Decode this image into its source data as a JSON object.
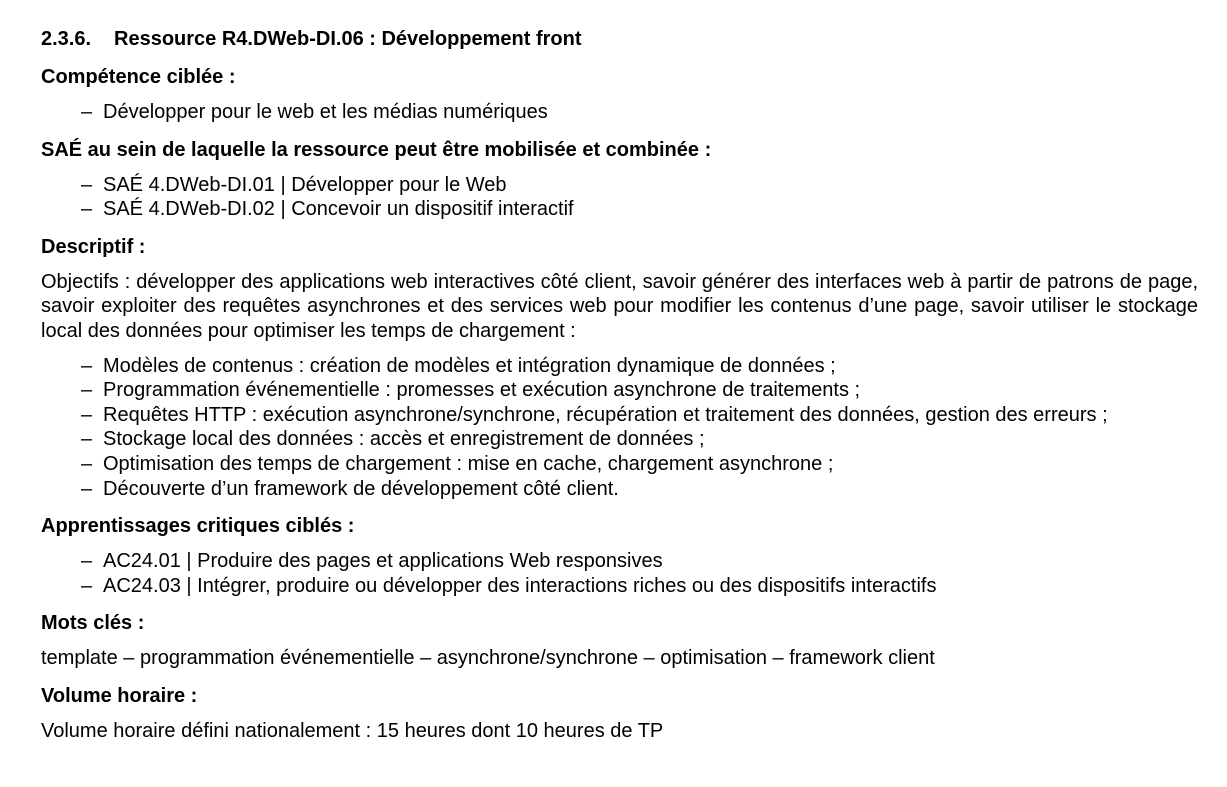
{
  "section": {
    "number": "2.3.6.",
    "title": "Ressource R4.DWeb-DI.06 : Développement front"
  },
  "competence": {
    "label": "Compétence ciblée :",
    "items": [
      "Développer pour le web et les médias numériques"
    ]
  },
  "sae": {
    "label": "SAÉ au sein de laquelle la ressource peut être mobilisée et combinée :",
    "items": [
      "SAÉ 4.DWeb-DI.01 | Développer pour le Web",
      "SAÉ 4.DWeb-DI.02 | Concevoir un dispositif interactif"
    ]
  },
  "descriptif": {
    "label": "Descriptif :",
    "paragraph": "Objectifs : développer des applications web interactives côté client, savoir générer des interfaces web à partir de patrons de page, savoir exploiter des requêtes asynchrones et des services web pour modifier les contenus d’une page, savoir utiliser le stockage local des données pour optimiser les temps de chargement :",
    "items": [
      "Modèles de contenus : création de modèles et intégration dynamique de données ;",
      "Programmation événementielle : promesses et exécution asynchrone de traitements ;",
      "Requêtes HTTP : exécution asynchrone/synchrone, récupération et traitement des données, gestion des erreurs ;",
      "Stockage local des données : accès et enregistrement de données ;",
      "Optimisation des temps de chargement : mise en cache, chargement asynchrone ;",
      "Découverte d’un framework de développement côté client."
    ]
  },
  "apprentissages": {
    "label": "Apprentissages critiques ciblés :",
    "items": [
      "AC24.01 | Produire des pages et applications Web responsives",
      "AC24.03 | Intégrer, produire ou développer des interactions riches ou des dispositifs interactifs"
    ]
  },
  "mots_cles": {
    "label": "Mots clés :",
    "text": "template – programmation événementielle – asynchrone/synchrone – optimisation – framework client"
  },
  "volume": {
    "label": "Volume horaire :",
    "text": "Volume horaire défini nationalement : 15 heures dont 10 heures de TP"
  },
  "list_marker": "–"
}
